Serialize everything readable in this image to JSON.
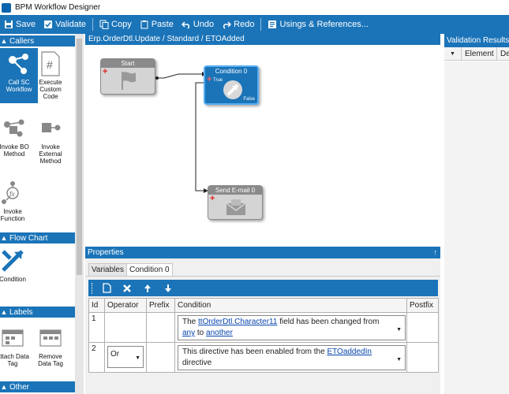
{
  "window": {
    "title": "BPM Workflow Designer"
  },
  "toolbar": {
    "save": "Save",
    "validate": "Validate",
    "copy": "Copy",
    "paste": "Paste",
    "undo": "Undo",
    "redo": "Redo",
    "usings": "Usings & References..."
  },
  "sidebar": {
    "callers": {
      "title": "Callers",
      "items": [
        "Call SC Workflow",
        "Execute Custom Code",
        "Invoke BO Method",
        "Invoke External Method",
        "Invoke Function"
      ]
    },
    "flowchart": {
      "title": "Flow Chart",
      "items": [
        "Condition"
      ]
    },
    "labels": {
      "title": "Labels",
      "items": [
        "Attach Data Tag",
        "Remove Data Tag"
      ]
    },
    "other": {
      "title": "Other"
    }
  },
  "canvas": {
    "breadcrumb": "Erp.OrderDtl.Update / Standard / ETOAdded",
    "nodes": {
      "start": "Start",
      "condition": "Condition 0",
      "condition_true": "True",
      "condition_false": "False",
      "send_email": "Send E-mail 0"
    }
  },
  "properties": {
    "title": "Properties",
    "pin": "↑",
    "tabs": [
      "Variables",
      "Condition 0"
    ],
    "columns": [
      "Id",
      "Operator",
      "Prefix",
      "Condition",
      "Postfix"
    ],
    "rows": [
      {
        "id": "1",
        "operator": "",
        "condition": {
          "pre": "The ",
          "link1": "ttOrderDtl.Character11",
          "mid": " field has been changed from ",
          "link2": "any",
          "mid2": " to ",
          "link3": "another"
        }
      },
      {
        "id": "2",
        "operator": "Or",
        "condition": {
          "pre": "This directive has been enabled from the ",
          "link1": "ETOaddedIn",
          "post": " directive"
        }
      }
    ]
  },
  "validation": {
    "title": "Validation Results",
    "columns": [
      "Element",
      "De"
    ]
  },
  "colors": {
    "accent": "#1b74b8",
    "accent_light": "#56aef5",
    "node_gray": "#d4d4d4",
    "plus_red": "#e02020"
  }
}
